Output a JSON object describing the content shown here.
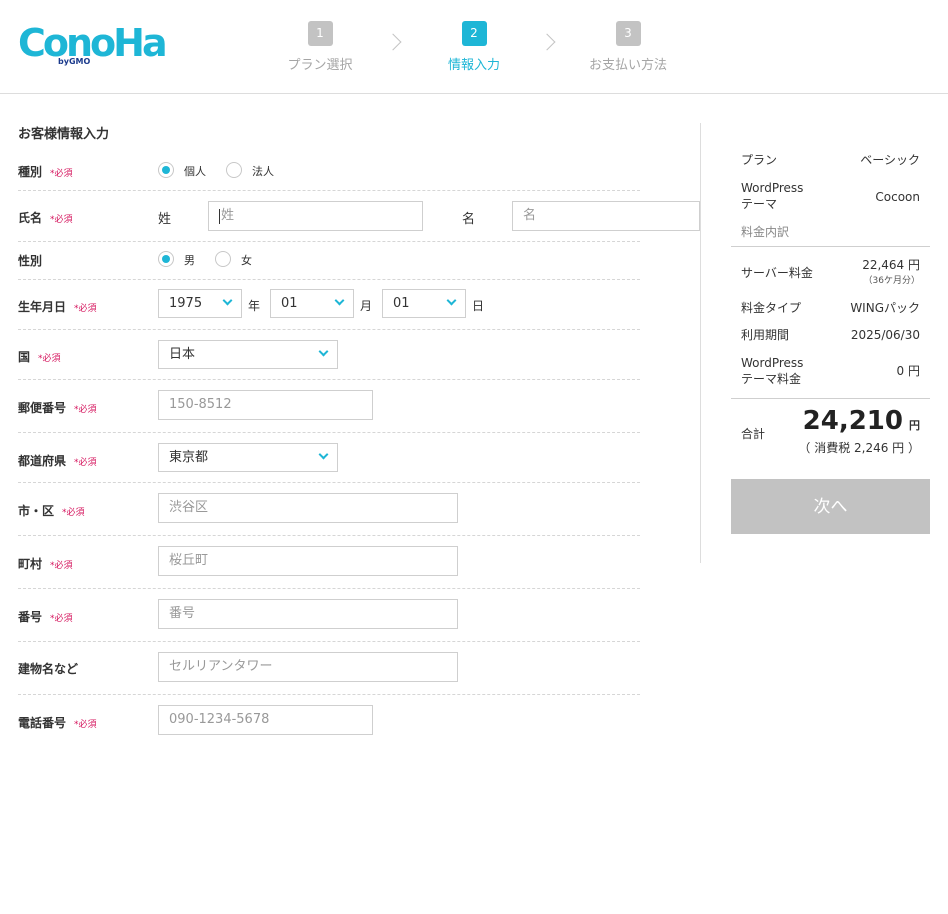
{
  "brand": {
    "logo_text": "ConoHa",
    "logo_sub": "byGMO"
  },
  "steps": [
    {
      "num": "1",
      "label": "プラン選択",
      "active": false
    },
    {
      "num": "2",
      "label": "情報入力",
      "active": true
    },
    {
      "num": "3",
      "label": "お支払い方法",
      "active": false
    }
  ],
  "form": {
    "title": "お客様情報入力",
    "required_mark": "*必須",
    "type": {
      "label": "種別",
      "options": [
        "個人",
        "法人"
      ],
      "selected": "個人"
    },
    "name": {
      "label": "氏名",
      "last_label": "姓",
      "last_placeholder": "姓",
      "first_label": "名",
      "first_placeholder": "名"
    },
    "gender": {
      "label": "性別",
      "options": [
        "男",
        "女"
      ],
      "selected": "男"
    },
    "birthday": {
      "label": "生年月日",
      "year": "1975",
      "year_unit": "年",
      "month": "01",
      "month_unit": "月",
      "day": "01",
      "day_unit": "日"
    },
    "country": {
      "label": "国",
      "value": "日本"
    },
    "postal": {
      "label": "郵便番号",
      "placeholder": "150-8512"
    },
    "prefecture": {
      "label": "都道府県",
      "value": "東京都"
    },
    "city": {
      "label": "市・区",
      "placeholder": "渋谷区"
    },
    "town": {
      "label": "町村",
      "placeholder": "桜丘町"
    },
    "address_no": {
      "label": "番号",
      "placeholder": "番号"
    },
    "building": {
      "label": "建物名など",
      "placeholder": "セルリアンタワー"
    },
    "phone": {
      "label": "電話番号",
      "placeholder": "090-1234-5678"
    }
  },
  "summary": {
    "plan_label": "プラン",
    "plan_value": "ベーシック",
    "theme_label_1": "WordPress",
    "theme_label_2": "テーマ",
    "theme_value": "Cocoon",
    "breakdown_label": "料金内訳",
    "server_label": "サーバー料金",
    "server_value": "22,464 円",
    "server_period": "（36ケ月分）",
    "fee_type_label": "料金タイプ",
    "fee_type_value": "WINGパック",
    "period_label": "利用期間",
    "period_value": "2025/06/30",
    "theme_fee_label_1": "WordPress",
    "theme_fee_label_2": "テーマ料金",
    "theme_fee_value": "0 円",
    "total_label": "合計",
    "total_value": "24,210",
    "total_unit": "円",
    "tax_note": "（ 消費税 2,246 円 ）",
    "next_button": "次へ"
  },
  "colors": {
    "accent": "#1eb6d6",
    "required": "#d5155d",
    "disabled_button": "#c2c2c2"
  }
}
